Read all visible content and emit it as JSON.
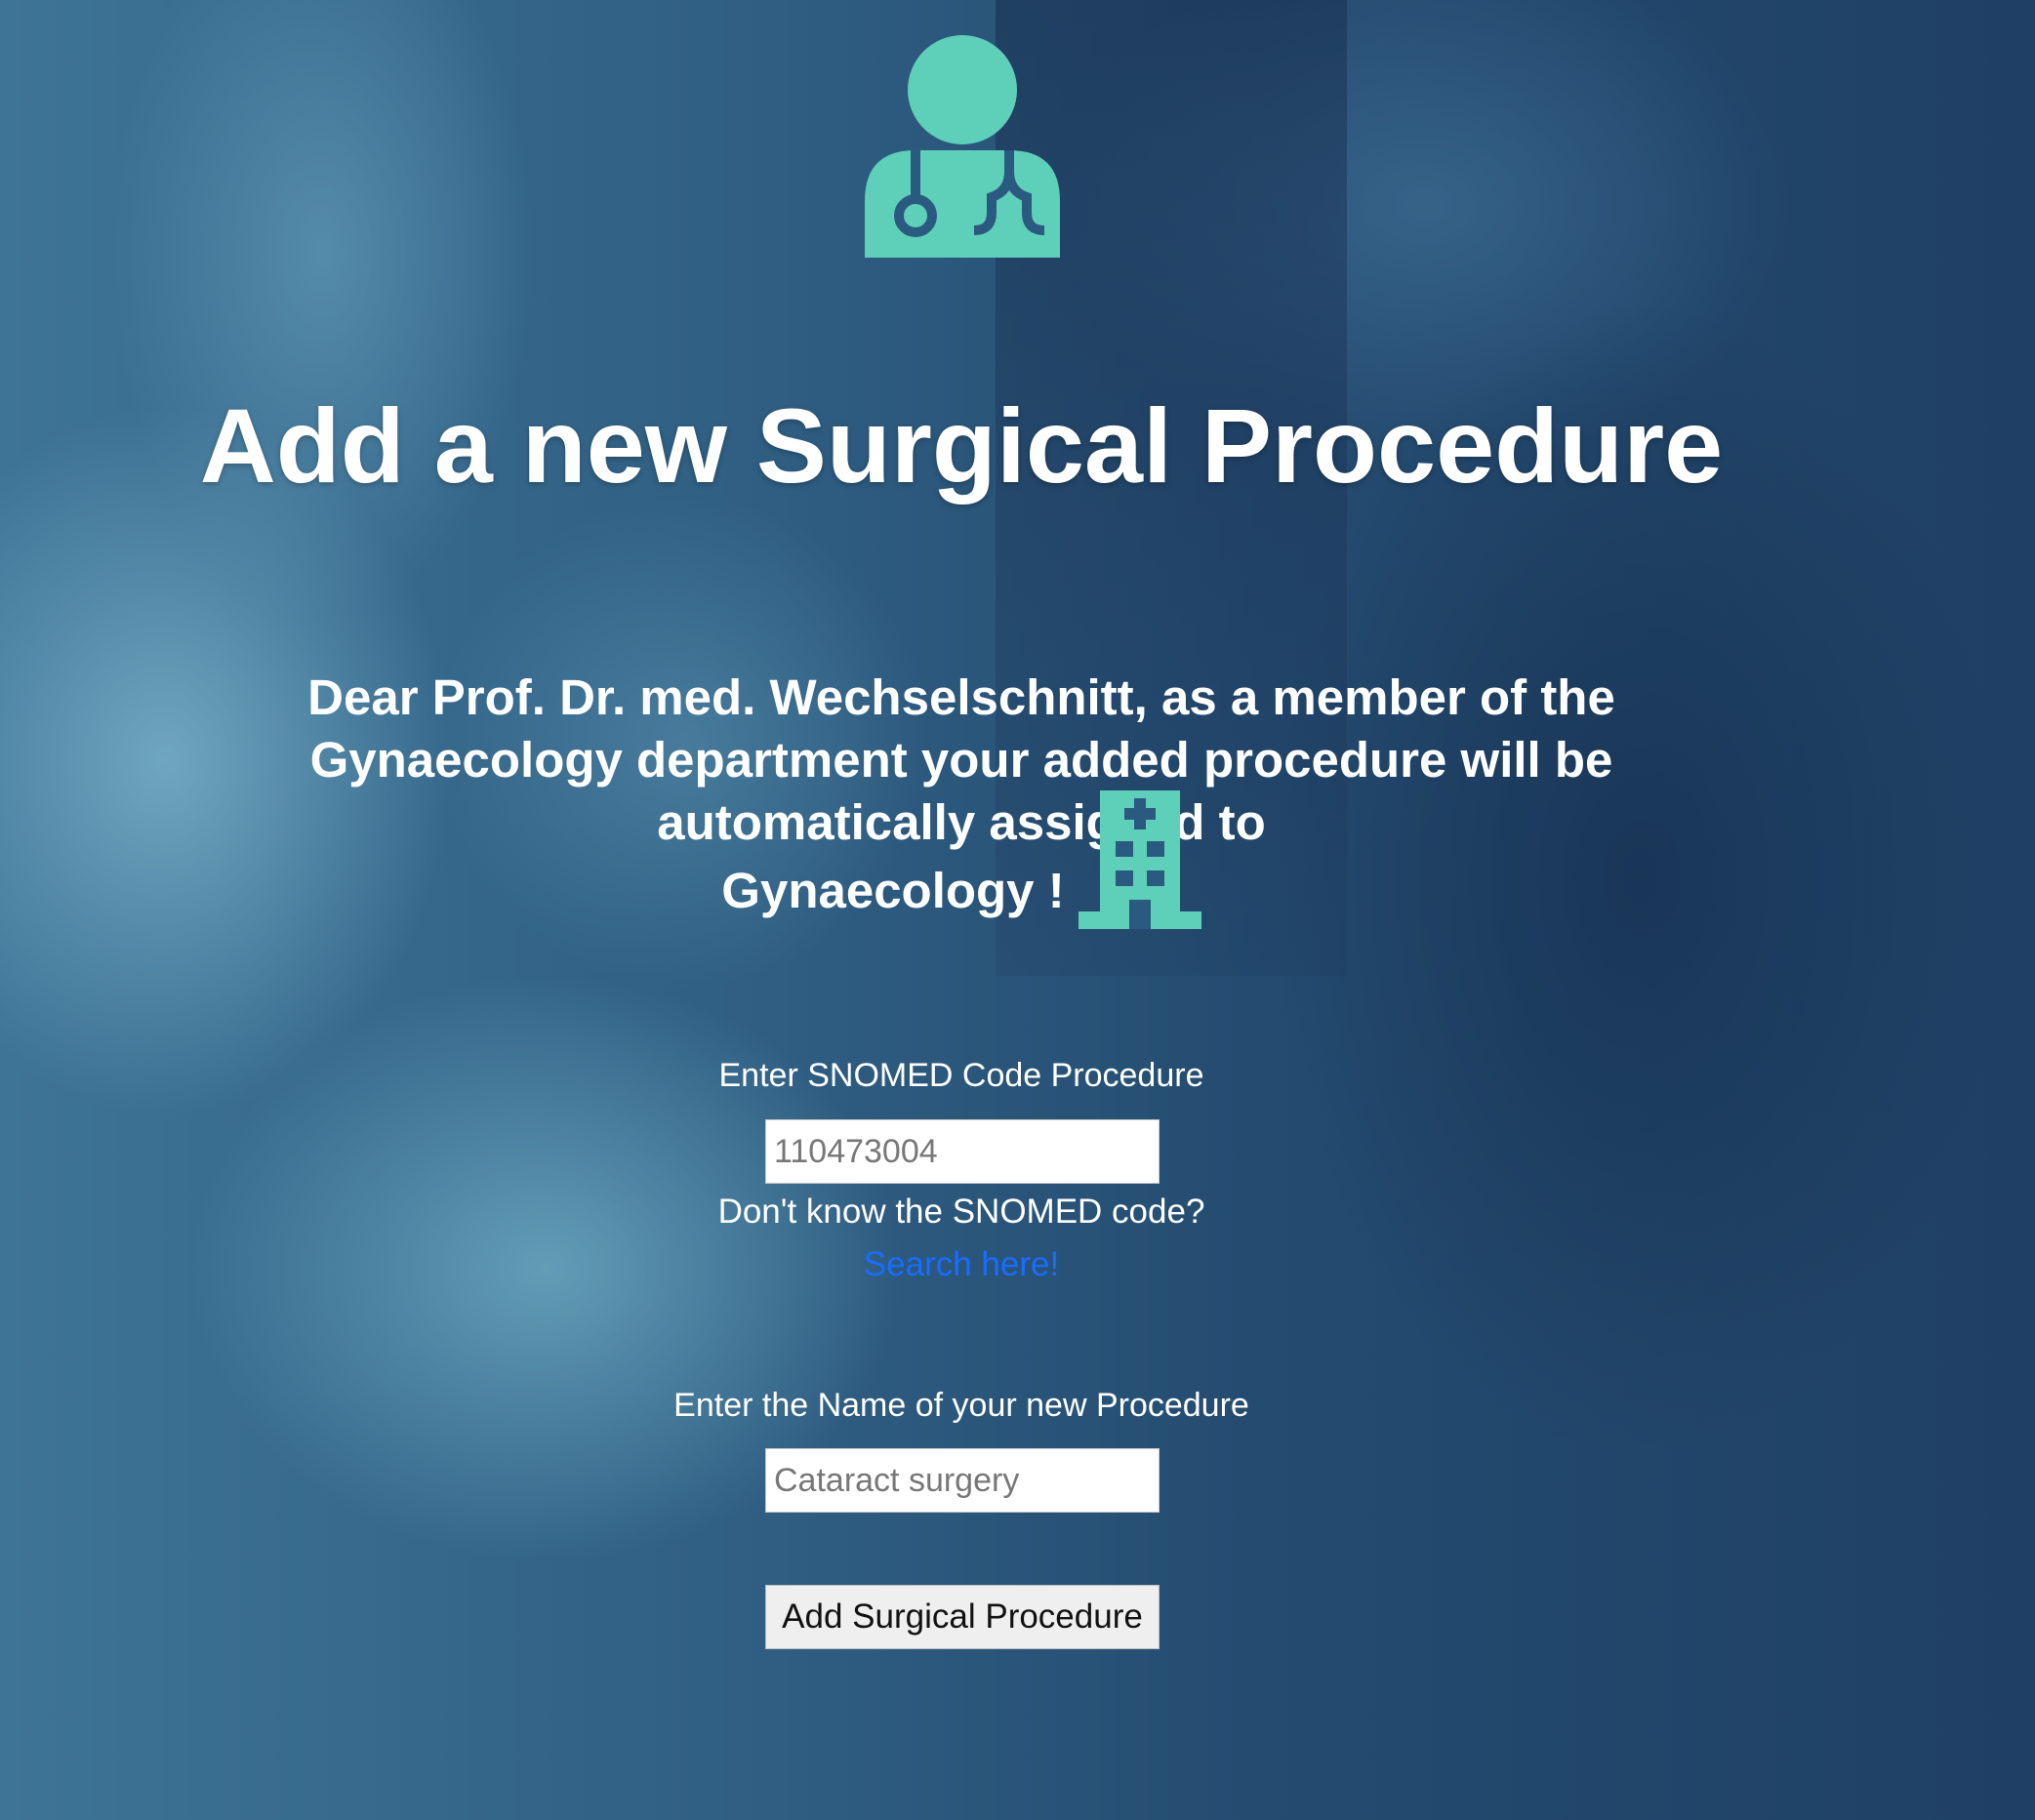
{
  "header": {
    "icon": "doctor-icon",
    "title": "Add a new Surgical Procedure"
  },
  "message": {
    "text": "Dear Prof. Dr. med. Wechselschnitt, as a member of the Gynaecology department your added procedure will be automatically assigned to",
    "department": "Gynaecology !",
    "department_icon": "hospital-icon"
  },
  "form": {
    "snomed_label": "Enter SNOMED Code Procedure",
    "snomed_placeholder": "110473004",
    "snomed_help": "Don't know the SNOMED code?",
    "snomed_search_link": "Search here!",
    "name_label": "Enter the Name of your new Procedure",
    "name_placeholder": "Cataract surgery",
    "submit_label": "Add Surgical Procedure"
  },
  "colors": {
    "accent": "#5ecfb8",
    "link": "#1a6cff",
    "background_tint": "#2f5e82"
  }
}
